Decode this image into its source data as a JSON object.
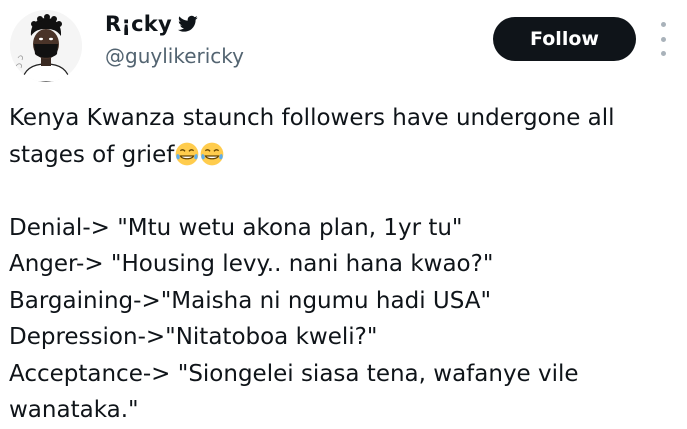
{
  "author": {
    "display_name": "R¡cky",
    "handle": "@guylikericky",
    "badge_icon": "bird-icon",
    "avatar_icon": "masked-man-avatar"
  },
  "actions": {
    "follow_label": "Follow",
    "more_icon": "more-vertical-icon"
  },
  "tweet": {
    "intro_line_1": "Kenya Kwanza staunch followers have undergone all",
    "intro_line_2": "stages of grief",
    "emoji": [
      "laughing-tears-emoji",
      "laughing-tears-emoji"
    ],
    "stages": [
      "Denial-> \"Mtu wetu akona plan, 1yr tu\"",
      "Anger-> \"Housing levy.. nani hana kwao?\"",
      "Bargaining->\"Maisha ni ngumu hadi USA\"",
      "Depression->\"Nitatoboa kweli?\"",
      "Acceptance-> \"Siongelei siasa tena, wafanye vile",
      "wanataka.\""
    ]
  },
  "colors": {
    "text": "#0f1419",
    "secondary_text": "#536471",
    "button_bg": "#0f1419",
    "button_text": "#ffffff",
    "emoji_face": "#ffcc4d"
  }
}
